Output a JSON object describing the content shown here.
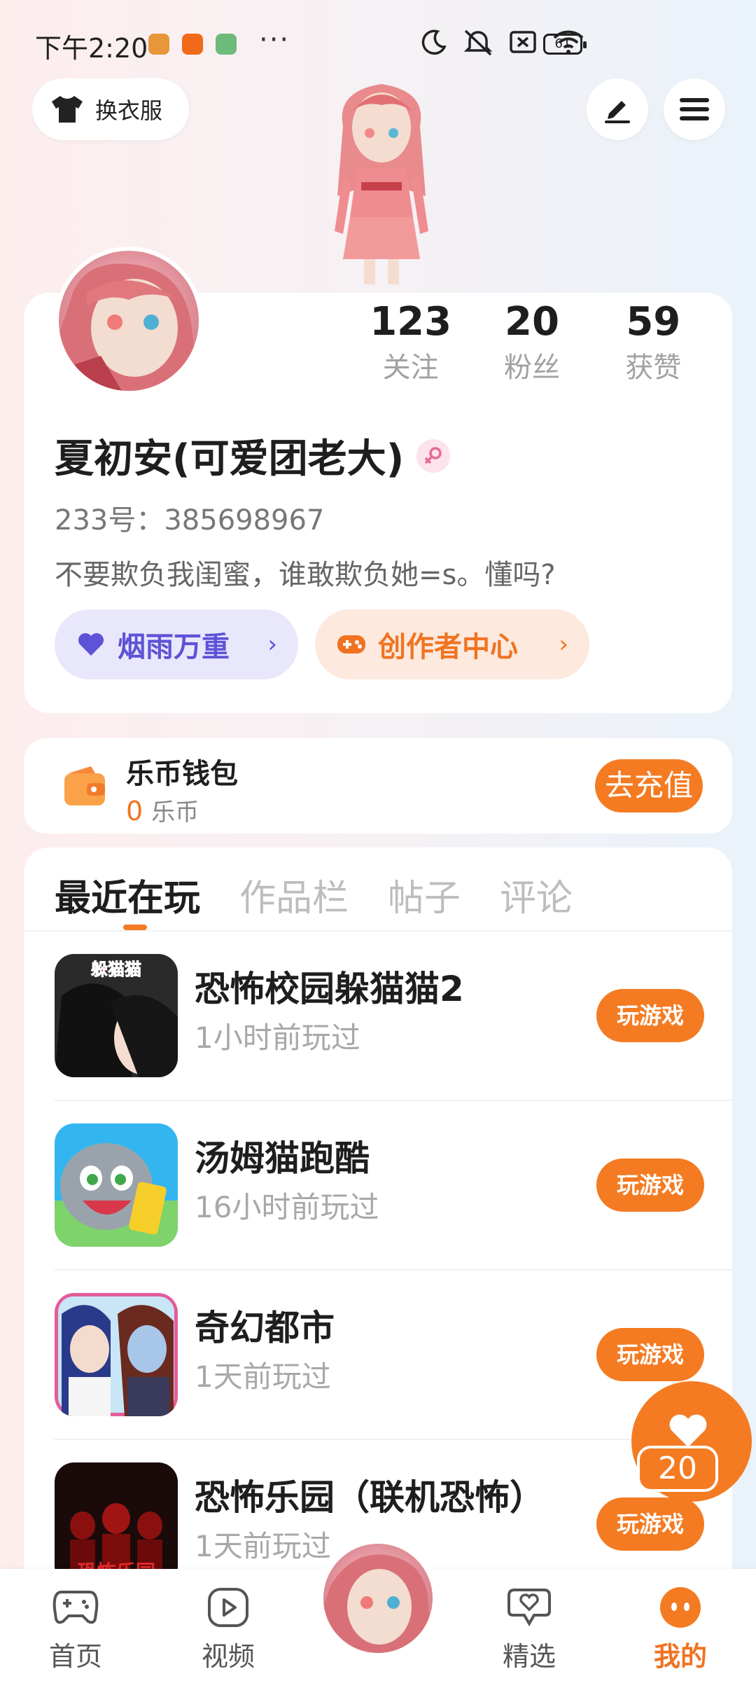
{
  "status_bar": {
    "time": "下午2:20",
    "dots": "···",
    "battery": "61"
  },
  "header": {
    "dress_label": "换衣服"
  },
  "profile": {
    "stats": [
      {
        "value": "123",
        "label": "关注"
      },
      {
        "value": "20",
        "label": "粉丝"
      },
      {
        "value": "59",
        "label": "获赞"
      }
    ],
    "nickname": "夏初安(可爱团老大)",
    "user_id": "233号：385698967",
    "bio": "不要欺负我闺蜜，谁敢欺负她=s。懂吗?",
    "family_tag": "烟雨万重",
    "creator_tag": "创作者中心",
    "chevron": "›"
  },
  "wallet": {
    "title": "乐币钱包",
    "amount": "0",
    "unit": "乐币",
    "recharge_label": "去充值"
  },
  "tabs": [
    "最近在玩",
    "作品栏",
    "帖子",
    "评论"
  ],
  "games": [
    {
      "name": "恐怖校园躲猫猫2",
      "time": "1小时前玩过",
      "play_label": "玩游戏",
      "thumb_text": "躲猫猫"
    },
    {
      "name": "汤姆猫跑酷",
      "time": "16小时前玩过",
      "play_label": "玩游戏"
    },
    {
      "name": "奇幻都市",
      "time": "1天前玩过",
      "play_label": "玩游戏"
    },
    {
      "name": "恐怖乐园（联机恐怖）",
      "time": "1天前玩过",
      "play_label": "玩游戏",
      "thumb_text": "恐怖乐园"
    }
  ],
  "float_like": {
    "count": "20"
  },
  "bottom_nav": [
    {
      "label": "首页",
      "icon": "gamepad-icon"
    },
    {
      "label": "视频",
      "icon": "play-icon"
    },
    {
      "label": "精选",
      "icon": "heart-chat-icon"
    },
    {
      "label": "我的",
      "icon": "face-icon"
    }
  ],
  "colors": {
    "accent": "#f47b22",
    "family": "#5e52d6",
    "family_bg": "#e9e7fb",
    "creator_bg": "#fde9de"
  }
}
